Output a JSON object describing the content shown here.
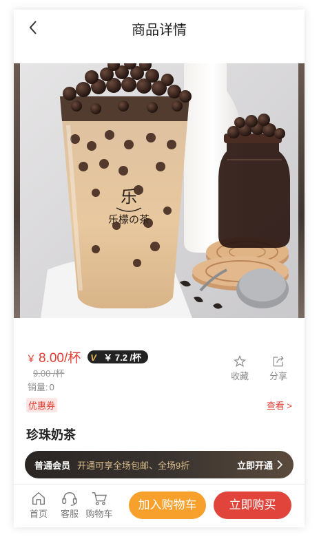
{
  "header": {
    "title": "商品详情",
    "back_icon": "chevron-left-icon"
  },
  "product": {
    "image_alt": "珍珠奶茶",
    "logo_glyph": "乐",
    "logo_text": "乐檬の茶",
    "price_symbol": "￥",
    "price": "8.00/杯",
    "vip_badge": "V",
    "vip_price": "￥ 7.2 /杯",
    "original_price": "9.00 /杯",
    "sales_label": "销量:",
    "sales_count": "0",
    "name": "珍珠奶茶"
  },
  "actions": {
    "favorite_label": "收藏",
    "share_label": "分享"
  },
  "coupon": {
    "tag": "优惠券",
    "view_label": "查看 >"
  },
  "membership": {
    "level": "普通会员",
    "description": "开通可享全场包邮、全场9折",
    "open_label": "立即开通"
  },
  "bottom_nav": {
    "home_label": "首页",
    "service_label": "客服",
    "cart_label": "购物车",
    "add_to_cart_label": "加入购物车",
    "buy_now_label": "立即购买"
  },
  "colors": {
    "accent_red": "#e03c31",
    "cart_orange": "#f7a02b",
    "buy_red": "#e0443b",
    "member_gold": "#d8bb8a"
  }
}
